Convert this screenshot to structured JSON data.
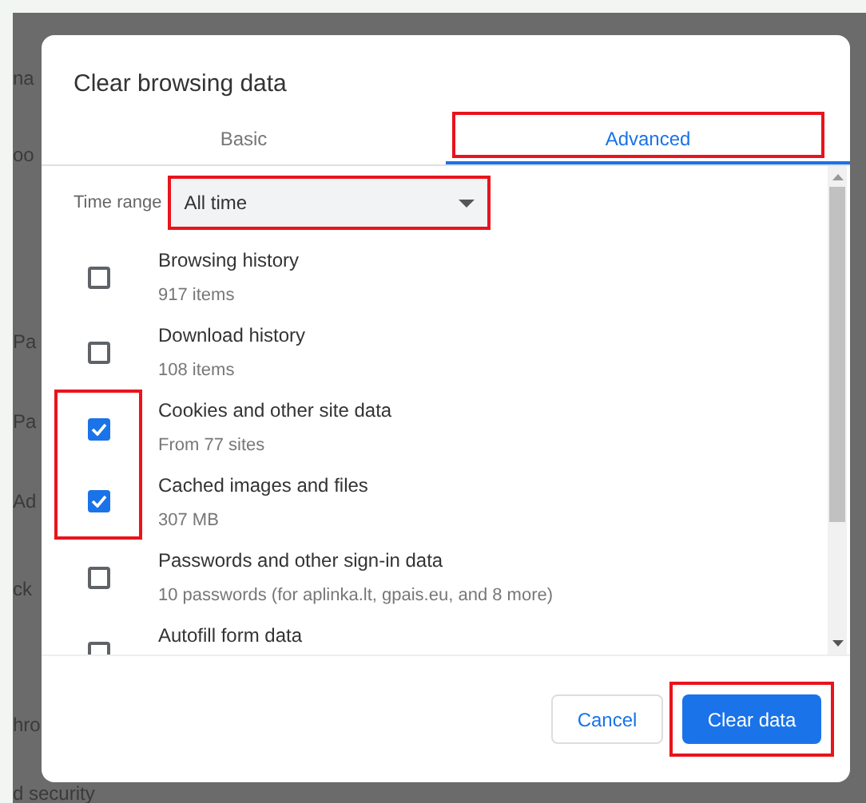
{
  "background_labels": [
    "na",
    "oo",
    "Pa",
    "Pa",
    "Ad",
    "ck",
    "hro",
    "d security"
  ],
  "dialog": {
    "title": "Clear browsing data",
    "tabs": [
      {
        "label": "Basic",
        "selected": false,
        "highlighted": false
      },
      {
        "label": "Advanced",
        "selected": true,
        "highlighted": true
      }
    ],
    "time_range": {
      "label": "Time range",
      "value": "All time",
      "highlighted": true
    },
    "items": [
      {
        "title": "Browsing history",
        "detail": "917 items",
        "checked": false,
        "highlighted": false
      },
      {
        "title": "Download history",
        "detail": "108 items",
        "checked": false,
        "highlighted": false
      },
      {
        "title": "Cookies and other site data",
        "detail": "From 77 sites",
        "checked": true,
        "highlighted": true
      },
      {
        "title": "Cached images and files",
        "detail": "307 MB",
        "checked": true,
        "highlighted": true
      },
      {
        "title": "Passwords and other sign-in data",
        "detail": "10 passwords (for aplinka.lt, gpais.eu, and 8 more)",
        "checked": false,
        "highlighted": false
      },
      {
        "title": "Autofill form data",
        "checked": false,
        "highlighted": false
      }
    ],
    "buttons": [
      {
        "label": "Cancel",
        "kind": "secondary",
        "highlighted": false
      },
      {
        "label": "Clear data",
        "kind": "primary",
        "highlighted": true
      }
    ]
  }
}
